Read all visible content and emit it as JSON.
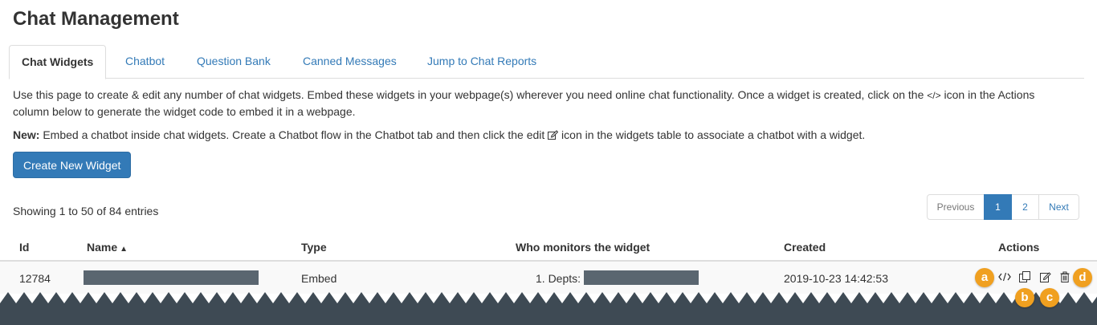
{
  "page": {
    "title": "Chat Management"
  },
  "tabs": [
    {
      "label": "Chat Widgets",
      "active": true
    },
    {
      "label": "Chatbot"
    },
    {
      "label": "Question Bank"
    },
    {
      "label": "Canned Messages"
    },
    {
      "label": "Jump to Chat Reports"
    }
  ],
  "intro": {
    "line1_a": "Use this page to create & edit any number of chat widgets. Embed these widgets in your webpage(s) wherever you need online chat functionality. Once a widget is created, click on the ",
    "code_glyph": "</>",
    "line1_b": " icon in the Actions column below to generate the widget code to embed it in a webpage.",
    "new_label": "New:",
    "new_a": " Embed a chatbot inside chat widgets. Create a Chatbot flow in the Chatbot tab and then click the edit ",
    "new_b": " icon in the widgets table to associate a chatbot with a widget."
  },
  "create_button": "Create New Widget",
  "showing_text": "Showing 1 to 50 of 84 entries",
  "pagination": {
    "previous": "Previous",
    "page1": "1",
    "page2": "2",
    "next": "Next"
  },
  "table": {
    "headers": {
      "id": "Id",
      "name": "Name",
      "type": "Type",
      "monitors": "Who monitors the widget",
      "created": "Created",
      "actions": "Actions"
    },
    "rows": [
      {
        "id": "12784",
        "type": "Embed",
        "monitors_label": "1. Depts:",
        "created": "2019-10-23 14:42:53"
      }
    ]
  },
  "action_icons": [
    "code-icon",
    "copy-icon",
    "edit-icon",
    "trash-icon"
  ],
  "callouts": [
    "a",
    "b",
    "c",
    "d"
  ],
  "colors": {
    "primary": "#337ab7",
    "callout": "#f0a020",
    "torn_edge": "#3e4a54",
    "redaction": "#5a6670"
  }
}
